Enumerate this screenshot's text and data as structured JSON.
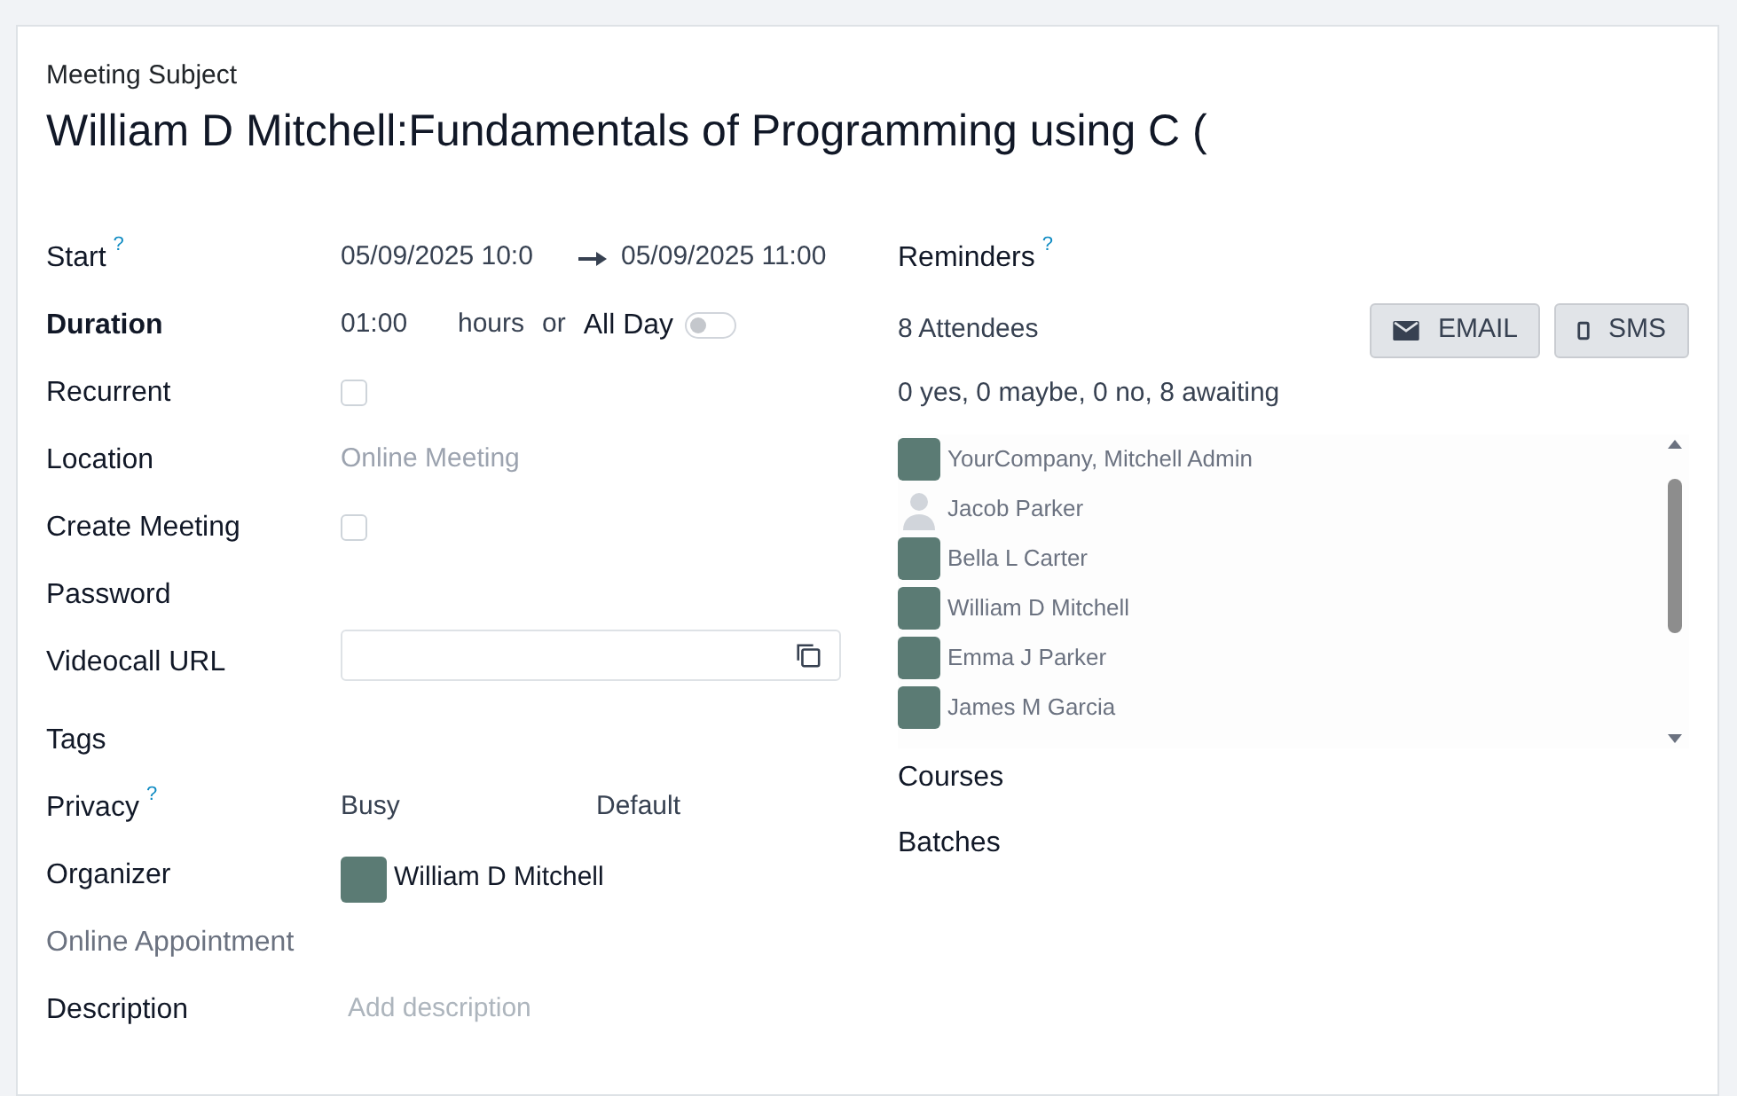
{
  "subject_label": "Meeting Subject",
  "subject": "William D Mitchell:Fundamentals of Programming using C (",
  "fields": [
    {
      "label": "Start",
      "kind": "range",
      "help": "?",
      "start": "05/09/2025 10:0",
      "end": "05/09/2025 11:00"
    },
    {
      "label": "Duration",
      "kind": "duration",
      "bold": true,
      "value": "01:00",
      "unit": "hours",
      "or": "or",
      "allday_label": "All Day",
      "allday_on": false
    },
    {
      "label": "Recurrent",
      "kind": "checkbox",
      "checked": false
    },
    {
      "label": "Location",
      "kind": "placeholder",
      "placeholder": "Online Meeting"
    },
    {
      "label": "Create Meeting",
      "kind": "checkbox",
      "checked": false
    },
    {
      "label": "Password",
      "kind": "empty"
    },
    {
      "label": "Videocall URL",
      "kind": "url"
    },
    {
      "label": "Tags",
      "kind": "empty"
    },
    {
      "label": "Privacy",
      "kind": "pair",
      "help": "?",
      "value": "Busy",
      "value_2": "Default"
    },
    {
      "label": "Organizer",
      "kind": "person",
      "value": "William D Mitchell"
    },
    {
      "label": "Online Appointment",
      "kind": "empty",
      "muted": true
    },
    {
      "label": "Description",
      "kind": "placeholder",
      "placeholder": "Add description"
    }
  ],
  "reminders": {
    "label": "Reminders",
    "help": "?"
  },
  "attendees_count": "8 Attendees",
  "buttons": [
    {
      "label": "EMAIL",
      "kind": "email"
    },
    {
      "label": "SMS",
      "kind": "sms"
    }
  ],
  "summary": "0 yes, 0 maybe, 0 no, 8 awaiting",
  "attendees": [
    {
      "name": "YourCompany, Mitchell Admin",
      "kind": "photo"
    },
    {
      "name": "Jacob Parker",
      "kind": "silhouette"
    },
    {
      "name": "Bella L Carter",
      "kind": "photo"
    },
    {
      "name": "William D Mitchell",
      "kind": "photo"
    },
    {
      "name": "Emma J Parker",
      "kind": "photo"
    },
    {
      "name": "James M Garcia",
      "kind": "photo"
    }
  ],
  "extra_fields": [
    "Courses",
    "Batches"
  ]
}
